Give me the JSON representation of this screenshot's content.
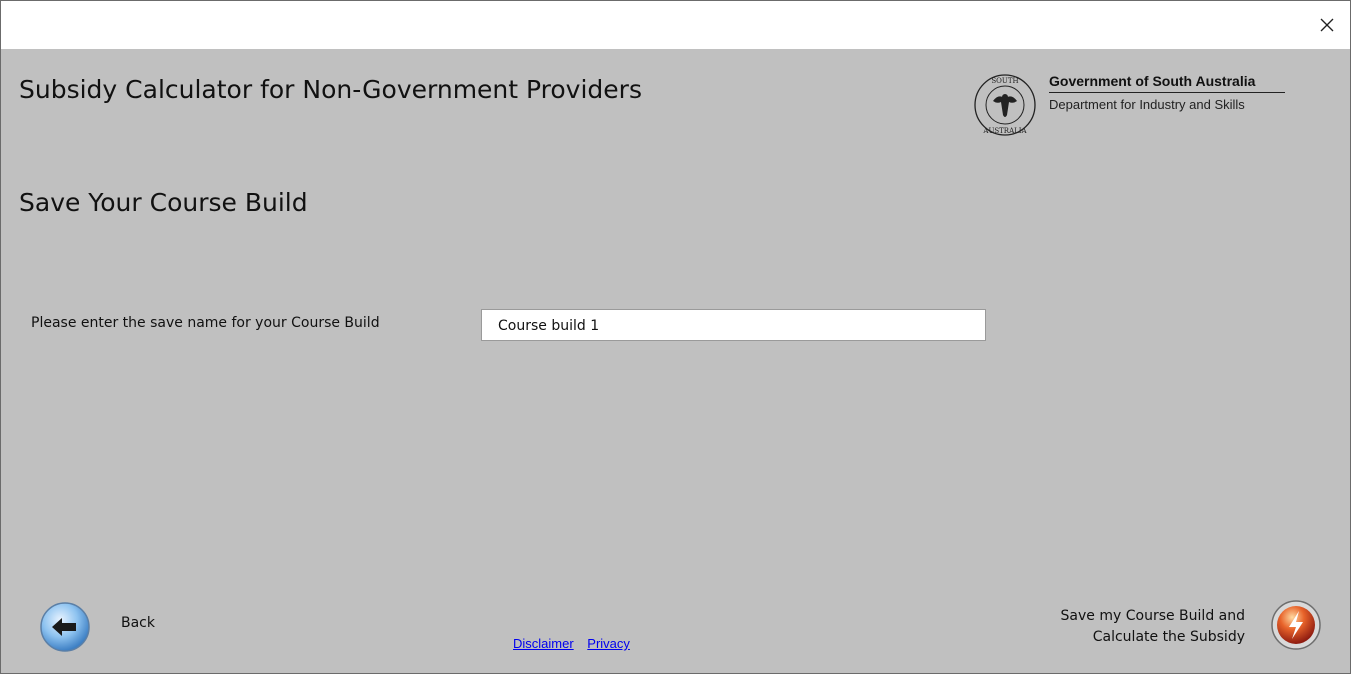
{
  "window": {
    "close_glyph": "×"
  },
  "header": {
    "app_title": "Subsidy Calculator for Non-Government Providers",
    "gov_name": "Government of South Australia",
    "dept_name": "Department for Industry and Skills",
    "seal_text": "SOUTH AUSTRALIA"
  },
  "page": {
    "title": "Save Your Course Build",
    "field_label": "Please enter the save name for your Course Build",
    "field_value": "Course build 1"
  },
  "footer": {
    "back_label": "Back",
    "disclaimer_link": "Disclaimer",
    "privacy_link": "Privacy",
    "save_line1": "Save my Course Build and",
    "save_line2": "Calculate the Subsidy",
    "back_icon": "arrow-left-icon",
    "save_icon": "lightning-icon"
  },
  "colors": {
    "background": "#c0c0c0",
    "link": "#0000ee",
    "save_button": "#c0392b",
    "back_button": "#6fa8dc"
  }
}
